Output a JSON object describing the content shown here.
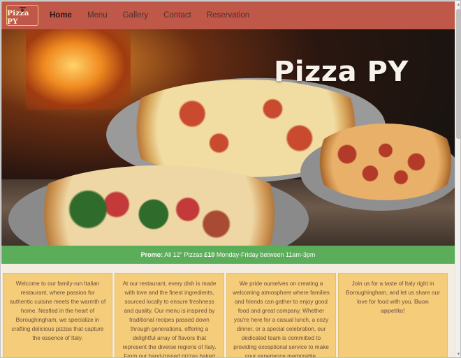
{
  "brand": {
    "name": "Pizza PY",
    "icon": "pizza-logo-icon"
  },
  "nav": {
    "items": [
      {
        "label": "Home",
        "active": true
      },
      {
        "label": "Menu",
        "active": false
      },
      {
        "label": "Gallery",
        "active": false
      },
      {
        "label": "Contact",
        "active": false
      },
      {
        "label": "Reservation",
        "active": false
      }
    ]
  },
  "hero": {
    "title": "Pizza PY"
  },
  "promo": {
    "label": "Promo:",
    "text_before": " All 12\" Pizzas ",
    "price": "£10",
    "text_after": " Monday-Friday between 11am-3pm"
  },
  "cards": [
    {
      "text": "Welcome to our family-run Italian restaurant, where passion for authentic cuisine meets the warmth of home. Nestled in the heart of Boroughingham, we specialize in crafting delicious pizzas that capture the essence of Italy.",
      "emphasis": ""
    },
    {
      "text": "At our restaurant, every dish is made with love and the finest ingredients, sourced locally to ensure freshness and quality. Our menu is inspired by traditional recipes passed down through generations, offering a delightful array of flavors that represent the diverse regions of Italy. From our hand-tossed pizzas baked to",
      "emphasis": ""
    },
    {
      "text": "We pride ourselves on creating a welcoming atmosphere where families and friends can gather to enjoy good food and great company. Whether you're here for a casual lunch, a cozy dinner, or a special celebration, our dedicated team is committed to providing exceptional service to make your experience memorable.",
      "emphasis": ""
    },
    {
      "text": "Join us for a taste of Italy right in Boroughingham, and let us share our love for food with you. ",
      "emphasis": "Buon appetito!"
    }
  ],
  "colors": {
    "navbar": "#c0584a",
    "promo": "#5cad5a",
    "card": "#f5cc7a",
    "content_bg": "#f4ecdf"
  }
}
